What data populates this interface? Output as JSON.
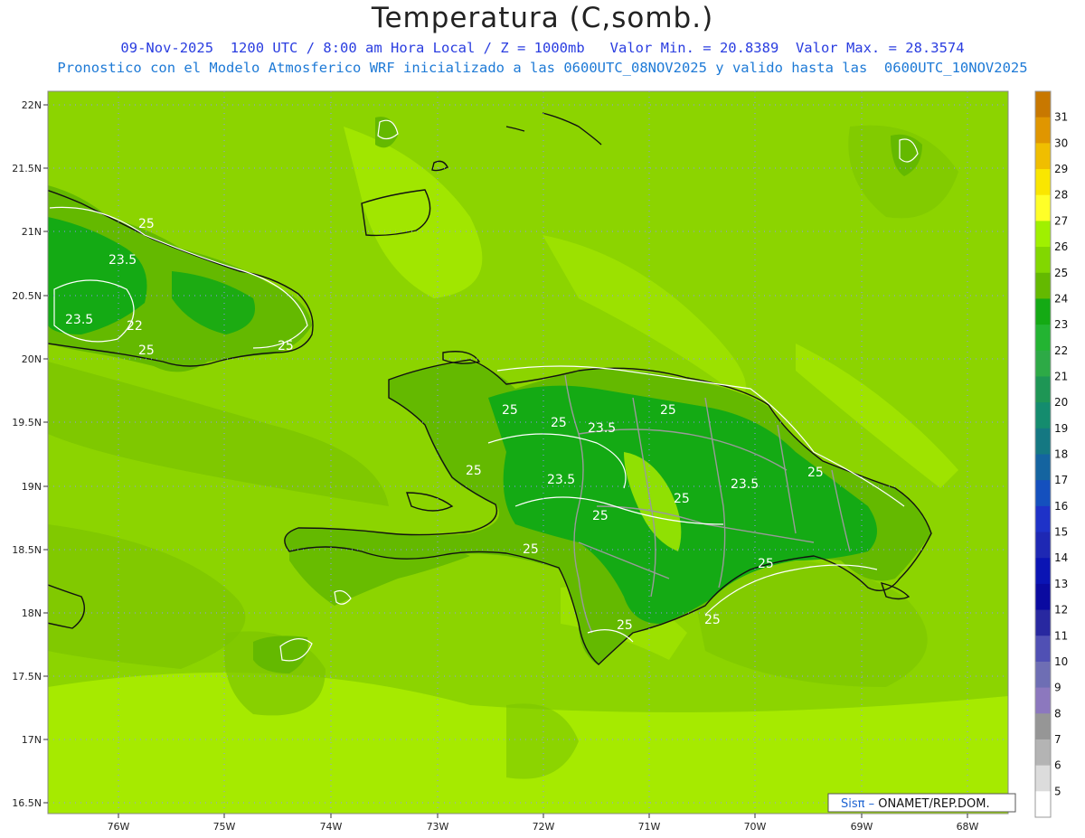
{
  "header": {
    "title": "Temperatura (C,somb.)",
    "line1": "09-Nov-2025  1200 UTC / 8:00 am Hora Local / Z = 1000mb   Valor Min. = 20.8389  Valor Max. = 28.3574",
    "line2": "Pronostico con el Modelo Atmosferico WRF inicializado a las 0600UTC_08NOV2025 y valido hasta las  0600UTC_10NOV2025"
  },
  "axes": {
    "lat_labels": [
      "22N",
      "21.5N",
      "21N",
      "20.5N",
      "20N",
      "19.5N",
      "19N",
      "18.5N",
      "18N",
      "17.5N",
      "17N",
      "16.5N"
    ],
    "lon_labels": [
      "76W",
      "75W",
      "74W",
      "73W",
      "72W",
      "71W",
      "70W",
      "69W",
      "68W"
    ]
  },
  "colorbar": {
    "labels": [
      "31",
      "30",
      "29",
      "28",
      "27",
      "26",
      "25",
      "24",
      "23",
      "22",
      "21",
      "20",
      "19",
      "18",
      "17",
      "16",
      "15",
      "14",
      "13",
      "12",
      "11",
      "10",
      "9",
      "8",
      "7",
      "6",
      "5"
    ],
    "colors": [
      "#c87800",
      "#e09600",
      "#f0be00",
      "#fae600",
      "#ffff28",
      "#a0f000",
      "#82d700",
      "#64b900",
      "#14aa14",
      "#23b432",
      "#2daa46",
      "#1e9655",
      "#148c6e",
      "#147882",
      "#1464a0",
      "#1450be",
      "#1e32c8",
      "#1e28b4",
      "#0a14b4",
      "#0a0aa0",
      "#2828a0",
      "#5050b4",
      "#6e6eb4",
      "#8c78be",
      "#969696",
      "#b4b4b4",
      "#dcdcdc",
      "#ffffff"
    ]
  },
  "contour_labels": [
    "25",
    "23.5",
    "23.5",
    "22",
    "25",
    "25",
    "25",
    "25",
    "23.5",
    "25",
    "25",
    "23.5",
    "25",
    "25",
    "25",
    "23.5",
    "25",
    "25",
    "25",
    "25"
  ],
  "credit": {
    "brand": "Sisπ –",
    "org": " ONAMET/REP.DOM."
  }
}
